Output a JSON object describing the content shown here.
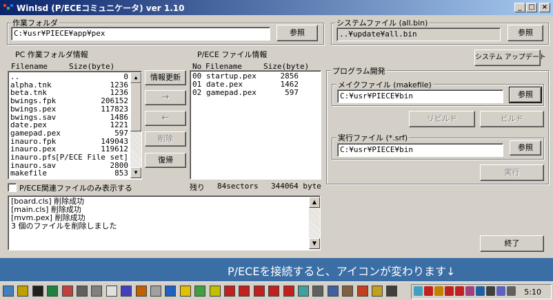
{
  "window": {
    "title": "WinIsd (P/ECEコミュニケータ) ver 1.10",
    "minimize": "_",
    "maximize": "□",
    "close": "×"
  },
  "work_folder": {
    "label": "作業フォルダ",
    "path": "C:¥usr¥PIECE¥app¥pex",
    "browse": "参照"
  },
  "system_file": {
    "label": "システムファイル (all.bin)",
    "path": "..¥update¥all.bin",
    "browse": "参照",
    "update": "システム アップデート"
  },
  "pc_list": {
    "label": "PC 作業フォルダ情報",
    "col_name": "Filename",
    "col_size": "Size(byte)",
    "rows": [
      {
        "name": "..",
        "size": "0"
      },
      {
        "name": "alpha.tnk",
        "size": "1236"
      },
      {
        "name": "beta.tnk",
        "size": "1236"
      },
      {
        "name": "bwings.fpk",
        "size": "206152"
      },
      {
        "name": "bwings.pex",
        "size": "117823"
      },
      {
        "name": "bwings.sav",
        "size": "1486"
      },
      {
        "name": "date.pex",
        "size": "1221"
      },
      {
        "name": "gamepad.pex",
        "size": "597"
      },
      {
        "name": "inauro.fpk",
        "size": "149043"
      },
      {
        "name": "inauro.pex",
        "size": "119612"
      },
      {
        "name": "inauro.pfs",
        "size": "[P/ECE File set]"
      },
      {
        "name": "inauro.sav",
        "size": "2800"
      },
      {
        "name": "makefile",
        "size": "853"
      }
    ]
  },
  "buttons": {
    "refresh": "情報更新",
    "to_piece": "→",
    "to_pc": "←",
    "delete": "削除",
    "restore": "復帰"
  },
  "piece_list": {
    "label": "P/ECE ファイル情報",
    "col_no": "No",
    "col_name": "Filename",
    "col_size": "Size(byte)",
    "rows": [
      {
        "no": "00",
        "name": "startup.pex",
        "size": "2856"
      },
      {
        "no": "01",
        "name": "date.pex",
        "size": "1462"
      },
      {
        "no": "02",
        "name": "gamepad.pex",
        "size": "597"
      }
    ],
    "remaining_label": "残り",
    "remaining_sectors": "84sectors",
    "remaining_bytes": "344064 byte"
  },
  "filter_checkbox": "P/ECE関連ファイルのみ表示する",
  "log": {
    "lines": [
      "[board.cls] 削除成功",
      "[main.cls] 削除成功",
      "[mvm.pex] 削除成功",
      "3 個のファイルを削除しました"
    ]
  },
  "program_dev": {
    "label": "プログラム開発",
    "makefile_label": "メイクファイル (makefile)",
    "makefile_path": "C:¥usr¥PIECE¥bin",
    "browse1": "参照",
    "rebuild": "リビルド",
    "build": "ビルド",
    "exec_label": "実行ファイル (*.srf)",
    "exec_path": "C:¥usr¥PIECE¥bin",
    "browse2": "参照",
    "run": "実行"
  },
  "exit": "終了",
  "banner": "P/ECEを接続すると、アイコンが変わります↓",
  "taskbar": {
    "clock": "5:10"
  },
  "colors": {
    "title_start": "#0a246a",
    "title_end": "#a6caf0",
    "banner": "#3a6ea5",
    "face": "#d4d0c8"
  }
}
